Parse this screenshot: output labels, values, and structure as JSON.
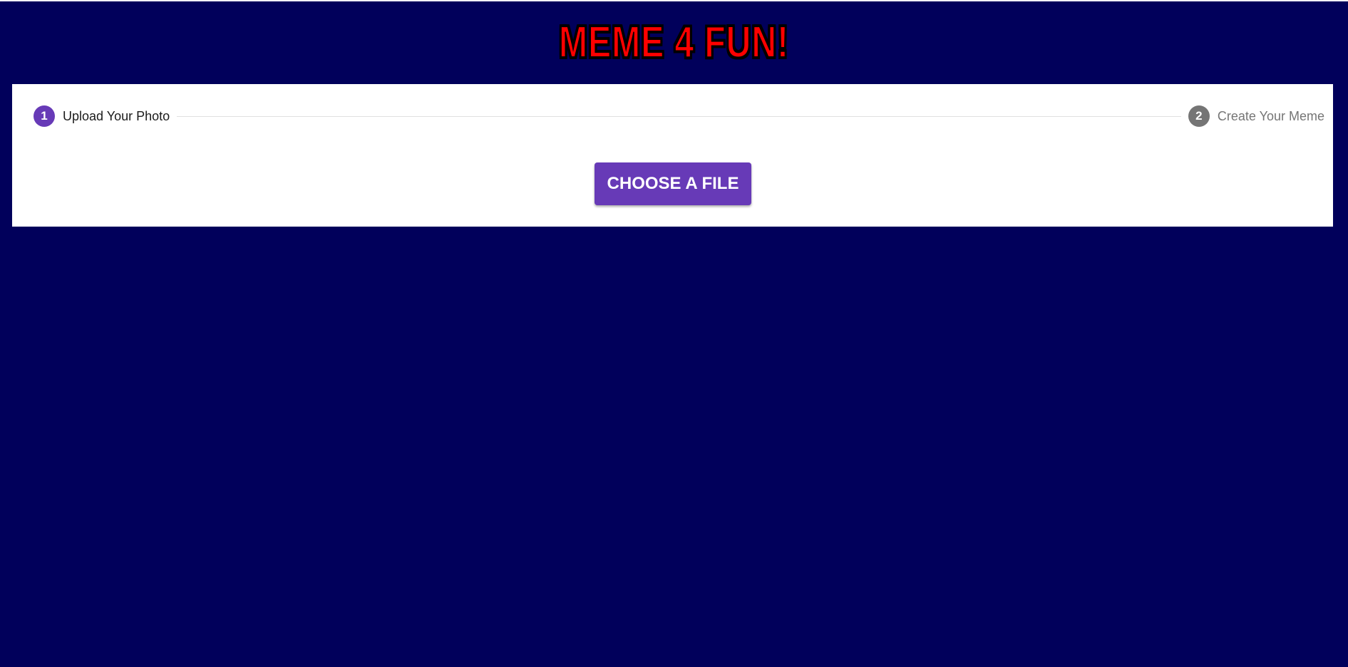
{
  "app": {
    "title": "MEME 4 FUN!"
  },
  "colors": {
    "background": "#01005b",
    "title_fill": "#ff0000",
    "title_outline": "#000000",
    "accent": "#673ab7",
    "inactive_step": "#757575",
    "card": "#ffffff"
  },
  "stepper": {
    "steps": [
      {
        "number": "1",
        "label": "Upload Your Photo",
        "state": "active"
      },
      {
        "number": "2",
        "label": "Create Your Meme",
        "state": "inactive"
      }
    ]
  },
  "upload": {
    "button_label": "CHOOSE A FILE"
  }
}
